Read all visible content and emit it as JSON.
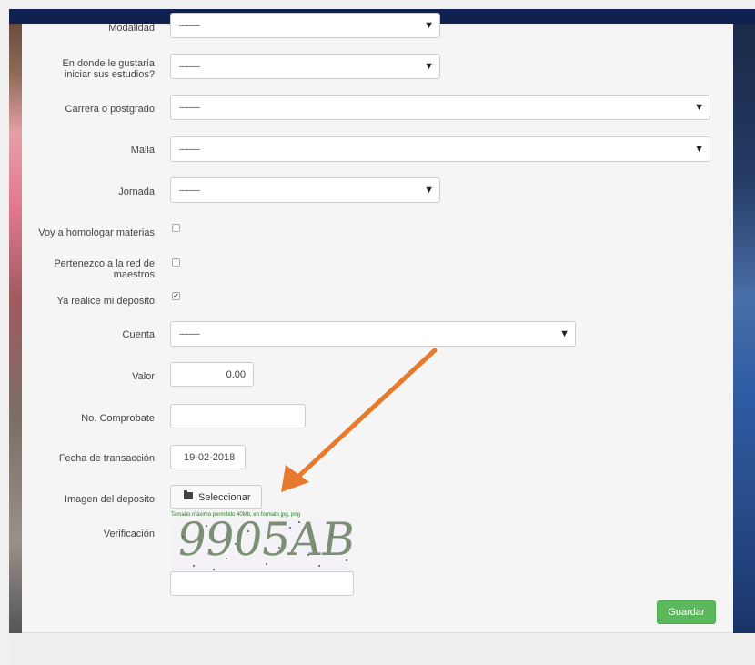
{
  "form": {
    "modalidad": {
      "label": "Modalidad",
      "value": "---------"
    },
    "inicio": {
      "label_line1": "En donde le gustaría",
      "label_line2": "iniciar sus estudios?",
      "value": "---------"
    },
    "carrera": {
      "label": "Carrera o postgrado",
      "value": "---------"
    },
    "malla": {
      "label": "Malla",
      "value": "---------"
    },
    "jornada": {
      "label": "Jornada",
      "value": "---------"
    },
    "homologar": {
      "label": "Voy a homologar materias",
      "checked": false
    },
    "red": {
      "label_line1": "Pertenezco a la red de",
      "label_line2": "maestros",
      "checked": false
    },
    "deposito": {
      "label": "Ya realice mi deposito",
      "checked": true,
      "mark": "✔"
    },
    "cuenta": {
      "label": "Cuenta",
      "value": "---------"
    },
    "valor": {
      "label": "Valor",
      "value": "0.00"
    },
    "comprobante": {
      "label": "No. Comprobate",
      "value": ""
    },
    "fecha": {
      "label": "Fecha de transacción",
      "value": "19-02-2018"
    },
    "imagen": {
      "label": "Imagen del deposito",
      "button": "Seleccionar",
      "icon": "folder-icon",
      "hint": "Tamaño máximo permitido 40Mb, en formato jpg, png"
    },
    "verificacion": {
      "label": "Verificación",
      "captcha_text": "9905AB",
      "value": ""
    },
    "submit": "Guardar"
  },
  "select_caret": "▼",
  "colors": {
    "topbar": "#0f2150",
    "submit": "#5cb85c",
    "arrow": "#e87a2e",
    "captcha_text": "#7a8f73",
    "hint": "#2a7a2a"
  }
}
